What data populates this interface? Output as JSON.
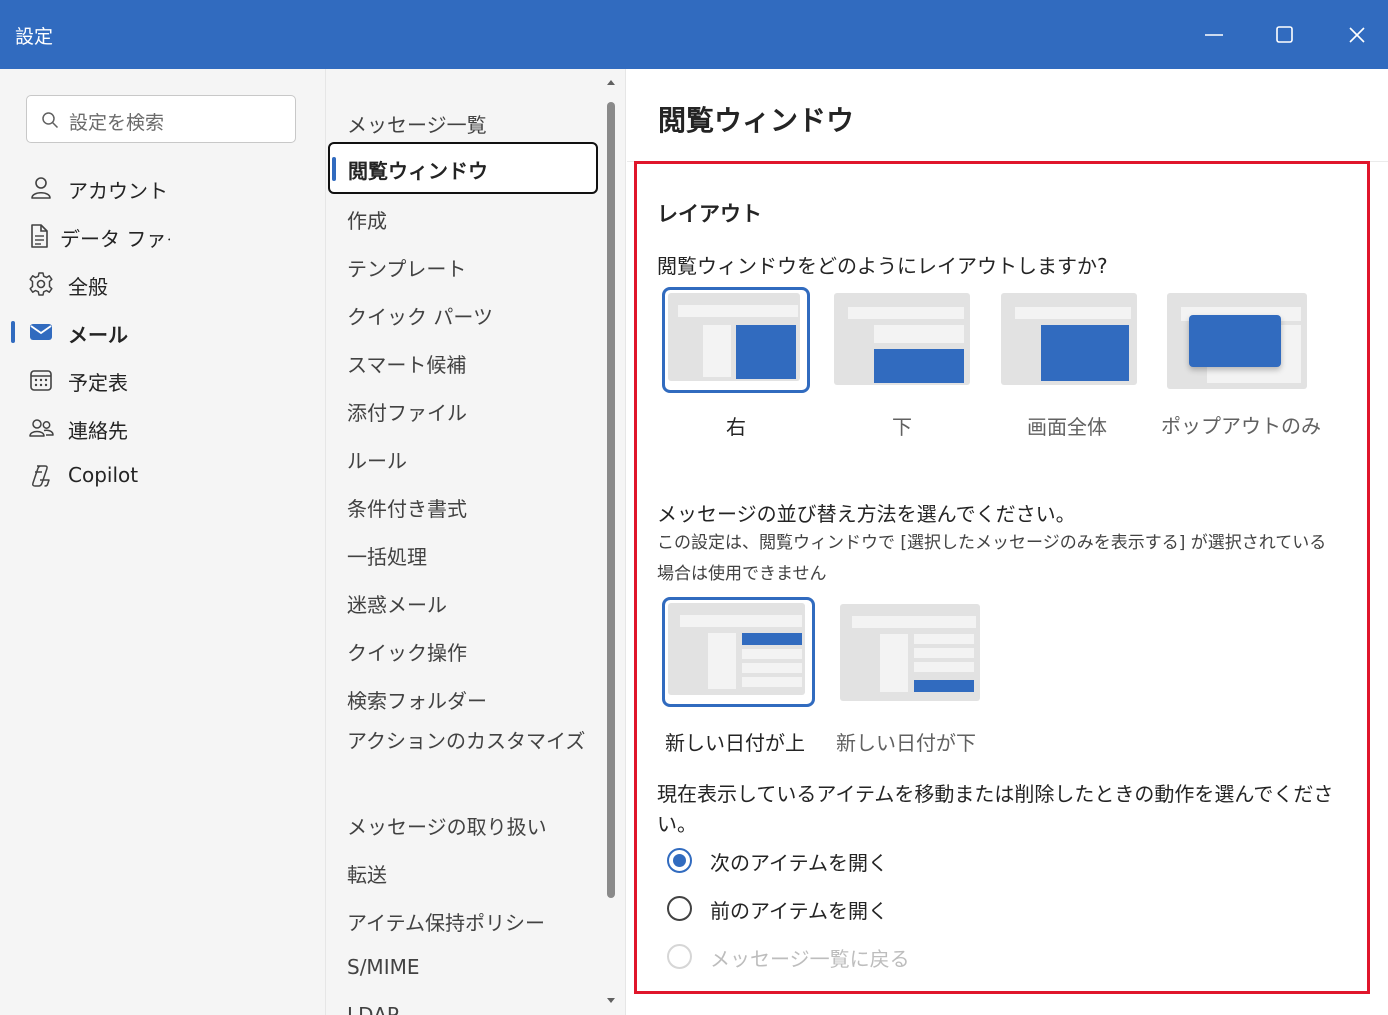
{
  "window": {
    "title": "設定"
  },
  "search": {
    "placeholder": "設定を検索"
  },
  "nav1": [
    {
      "label": "アカウント",
      "icon": "person-icon"
    },
    {
      "label": "データ ファイル",
      "icon": "document-icon"
    },
    {
      "label": "全般",
      "icon": "gear-icon"
    },
    {
      "label": "メール",
      "icon": "mail-icon",
      "active": true
    },
    {
      "label": "予定表",
      "icon": "calendar-icon"
    },
    {
      "label": "連絡先",
      "icon": "people-icon"
    },
    {
      "label": "Copilot",
      "icon": "copilot-icon"
    }
  ],
  "nav2": [
    "メッセージ一覧",
    "閲覧ウィンドウ",
    "作成",
    "テンプレート",
    "クイック パーツ",
    "スマート候補",
    "添付ファイル",
    "ルール",
    "条件付き書式",
    "一括処理",
    "迷惑メール",
    "クイック操作",
    "検索フォルダー",
    "アクションのカスタマイズ",
    "メッセージの取り扱い",
    "転送",
    "アイテム保持ポリシー",
    "S/MIME",
    "LDAP"
  ],
  "nav2_selected": "閲覧ウィンドウ",
  "content": {
    "title": "閲覧ウィンドウ",
    "layout_section": "レイアウト",
    "layout_question": "閲覧ウィンドウをどのようにレイアウトしますか?",
    "layout_options": [
      "右",
      "下",
      "画面全体",
      "ポップアウトのみ"
    ],
    "layout_selected": "右",
    "sort_question": "メッセージの並び替え方法を選んでください。",
    "sort_note": "この設定は、閲覧ウィンドウで [選択したメッセージのみを表示する] が選択されている場合は使用できません",
    "sort_options": [
      "新しい日付が上",
      "新しい日付が下"
    ],
    "sort_selected": "新しい日付が上",
    "action_question": "現在表示しているアイテムを移動または削除したときの動作を選んでください。",
    "action_options": [
      {
        "label": "次のアイテムを開く",
        "checked": true,
        "disabled": false
      },
      {
        "label": "前のアイテムを開く",
        "checked": false,
        "disabled": false
      },
      {
        "label": "メッセージ一覧に戻る",
        "checked": false,
        "disabled": true
      }
    ]
  },
  "colors": {
    "accent": "#316bbf",
    "highlight_border": "#e0162b",
    "titlebar": "#316bbf"
  }
}
